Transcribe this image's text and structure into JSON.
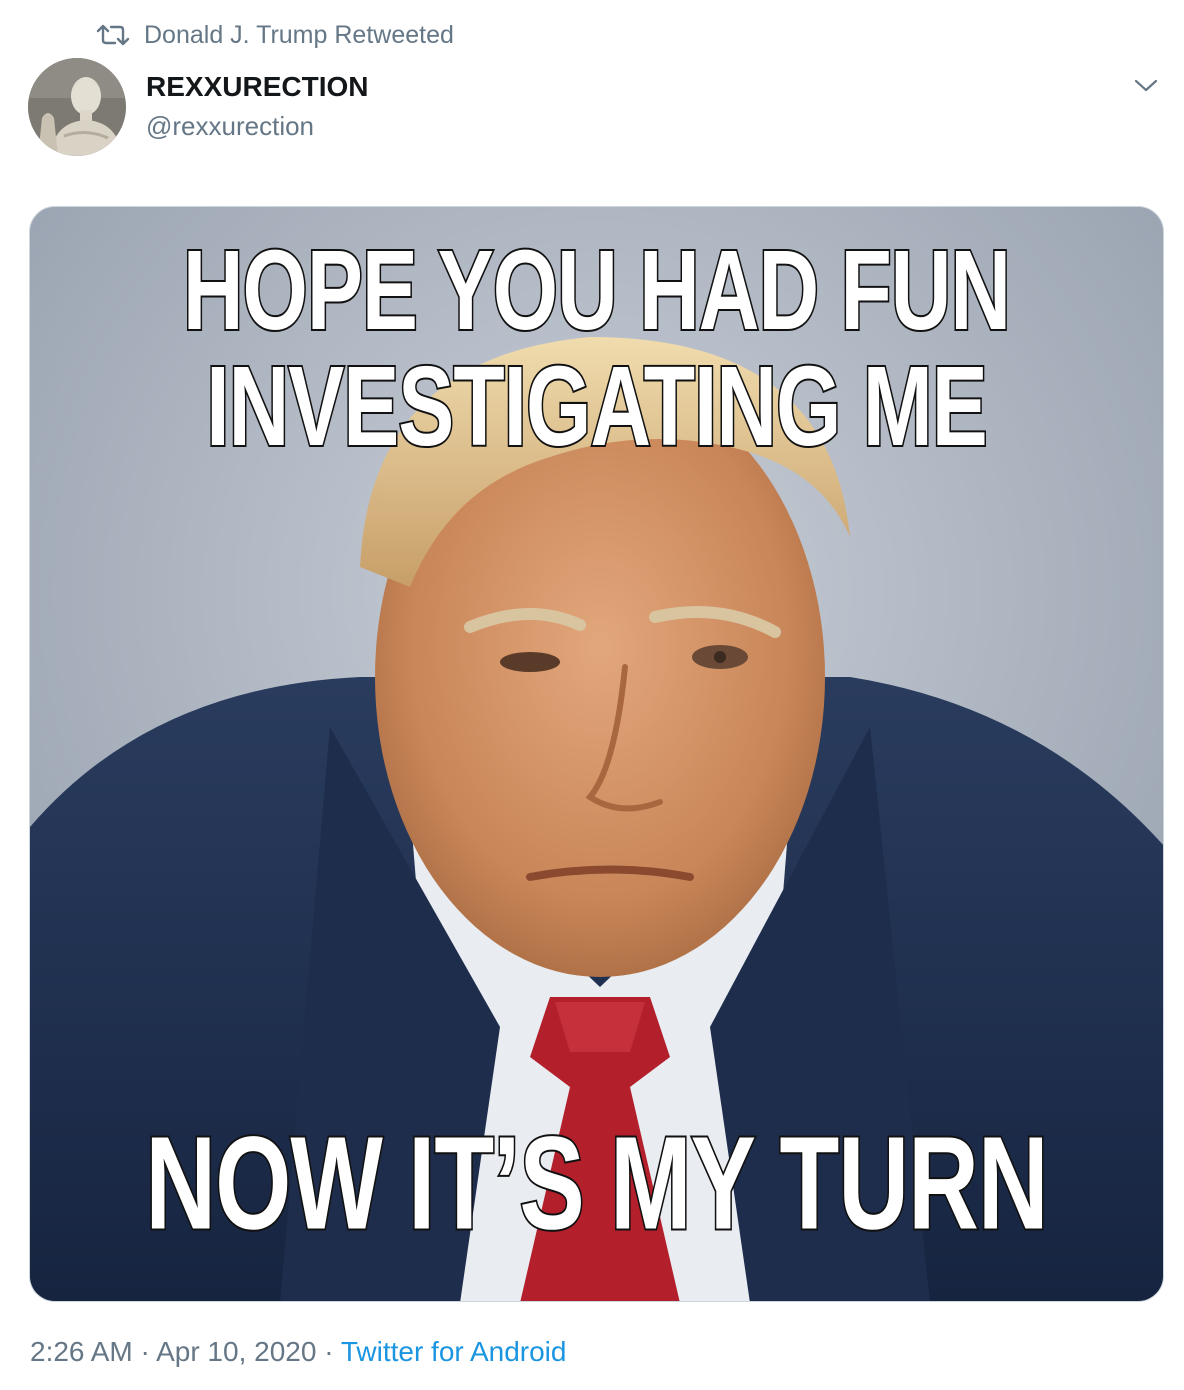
{
  "retweet": {
    "icon": "retweet-icon",
    "text": "Donald J. Trump Retweeted"
  },
  "author": {
    "avatar_icon": "avatar-statue",
    "display_name": "REXXURECTION",
    "handle": "@rexxurection"
  },
  "menu": {
    "icon": "chevron-down-icon"
  },
  "media": {
    "top_line_1": "HOPE YOU HAD FUN",
    "top_line_2": "INVESTIGATING ME",
    "bottom_line": "NOW IT’S MY TURN"
  },
  "meta": {
    "time": "2:26 AM",
    "separator": "·",
    "date": "Apr 10, 2020",
    "source": "Twitter for Android"
  },
  "colors": {
    "text_primary": "#14171a",
    "text_secondary": "#657786",
    "link": "#1b95e0",
    "border": "#ccd6dd"
  }
}
